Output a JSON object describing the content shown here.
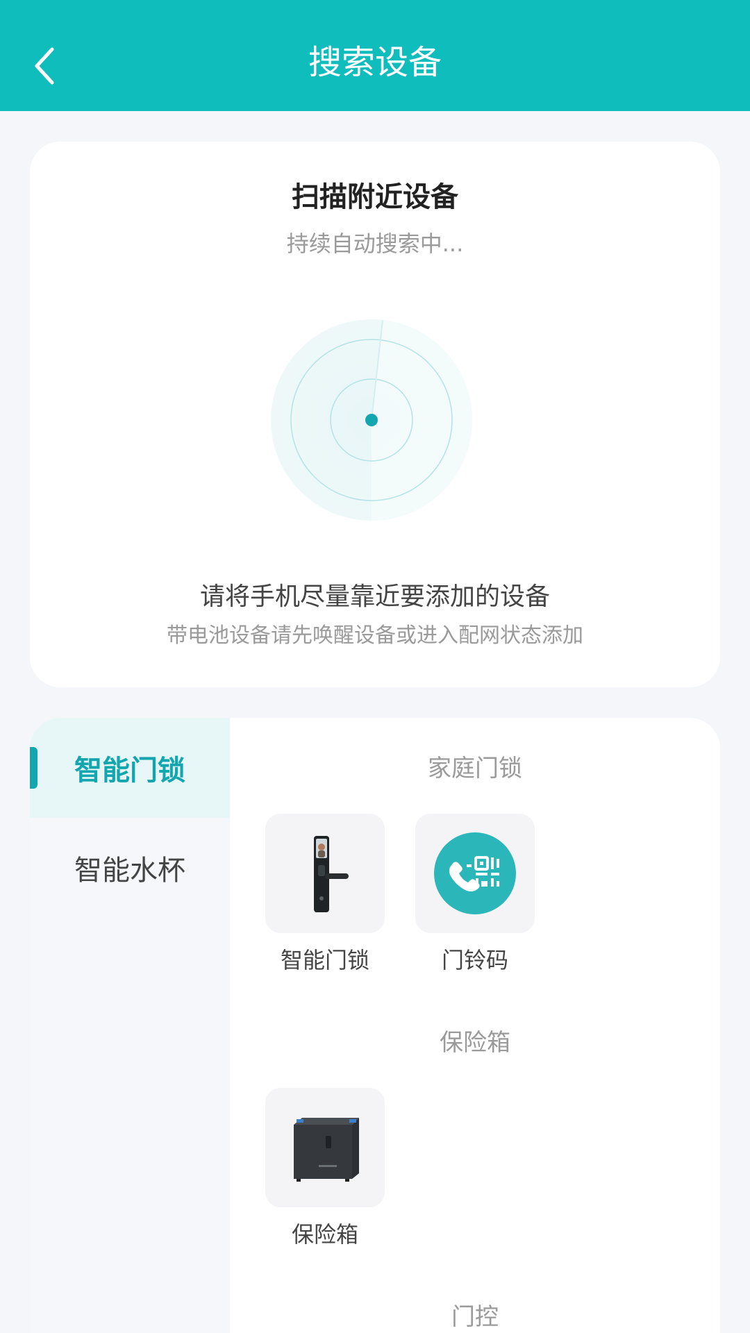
{
  "header": {
    "title": "搜索设备",
    "back_icon": "chevron-left-icon"
  },
  "scan": {
    "title": "扫描附近设备",
    "subtitle": "持续自动搜索中...",
    "hint_main": "请将手机尽量靠近要添加的设备",
    "hint_sub": "带电池设备请先唤醒设备或进入配网状态添加"
  },
  "categories": [
    {
      "label": "智能门锁",
      "active": true
    },
    {
      "label": "智能水杯",
      "active": false
    }
  ],
  "sections": [
    {
      "title": "家庭门锁",
      "items": [
        {
          "label": "智能门锁"
        },
        {
          "label": "门铃码"
        }
      ]
    },
    {
      "title": "保险箱",
      "items": [
        {
          "label": "保险箱"
        }
      ]
    },
    {
      "title": "门控",
      "items": []
    }
  ],
  "colors": {
    "primary": "#0fbdbd",
    "accent": "#14a6ae",
    "background": "#f4f6f9"
  }
}
